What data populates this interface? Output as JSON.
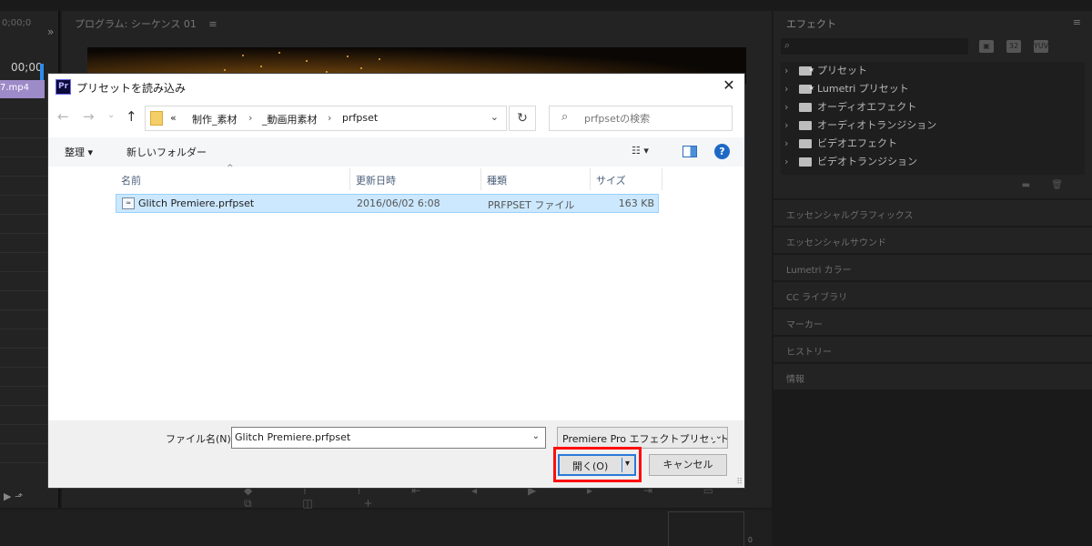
{
  "premiere": {
    "left_panel": {
      "timecode": "0;00;0",
      "seq_timecode": "00;00",
      "clip_label": "7.mp4",
      "expand_icon": "double-chevron-right",
      "bottom_icons": "▶ ⬏"
    },
    "program_monitor": {
      "title": "プログラム: シーケンス 01",
      "menu_icon": "≡",
      "transport_icons": "◆ ⁞ ⁞ ⇤ ◂ ▶ ▸ ⇥ ▭ ⧉ ◫ +"
    },
    "effects_panel": {
      "title": "エフェクト",
      "menu_icon": "≡",
      "search_icon": "⌕",
      "tools": [
        "▣",
        "32",
        "YUV"
      ],
      "items": [
        {
          "label": "プリセット",
          "starred": true
        },
        {
          "label": "Lumetri プリセット",
          "starred": true
        },
        {
          "label": "オーディオエフェクト",
          "starred": false
        },
        {
          "label": "オーディオトランジション",
          "starred": false
        },
        {
          "label": "ビデオエフェクト",
          "starred": false
        },
        {
          "label": "ビデオトランジション",
          "starred": false
        }
      ],
      "footer_icons": "▬ 🗑"
    },
    "side_sections": [
      "エッセンシャルグラフィックス",
      "エッセンシャルサウンド",
      "Lumetri カラー",
      "CC ライブラリ",
      "マーカー",
      "ヒストリー",
      "情報"
    ],
    "bottom_vu_label": "0"
  },
  "dialog": {
    "app_icon": "Pr",
    "title": "プリセットを読み込み",
    "close_icon": "✕",
    "nav": {
      "back_icon": "←",
      "forward_icon": "→",
      "recent_icon": "⌄",
      "up_icon": "↑"
    },
    "address": {
      "overflow": "«",
      "crumbs": [
        "制作_素材",
        "_動画用素材",
        "prfpset"
      ],
      "separator": "›",
      "dropdown_icon": "⌄"
    },
    "refresh_icon": "↻",
    "search": {
      "icon": "⌕",
      "placeholder": "prfpsetの検索"
    },
    "commands": {
      "organize": "整理 ▾",
      "new_folder": "新しいフォルダー",
      "view_icon": "☷ ▾",
      "help_icon": "?"
    },
    "columns": [
      "名前",
      "更新日時",
      "種類",
      "サイズ"
    ],
    "sort_indicator": "^",
    "files": [
      {
        "icon": "≈",
        "name": "Glitch Premiere.prfpset",
        "modified": "2016/06/02 6:08",
        "type": "PRFPSET ファイル",
        "size": "163 KB"
      }
    ],
    "footer": {
      "filename_label": "ファイル名(N):",
      "filename_value": "Glitch Premiere.prfpset",
      "filename_dropdown": "⌄",
      "filetype": "Premiere Pro エフェクトプリセット (*",
      "filetype_dropdown": "⌄",
      "open_label": "開く(O)",
      "open_dropdown": "▾",
      "cancel_label": "キャンセル",
      "grip_icon": "⠿"
    }
  },
  "colors": {
    "accent_highlight": "#ff0d0d",
    "selection": "#cce8ff",
    "clip": "#9d8ac8"
  }
}
